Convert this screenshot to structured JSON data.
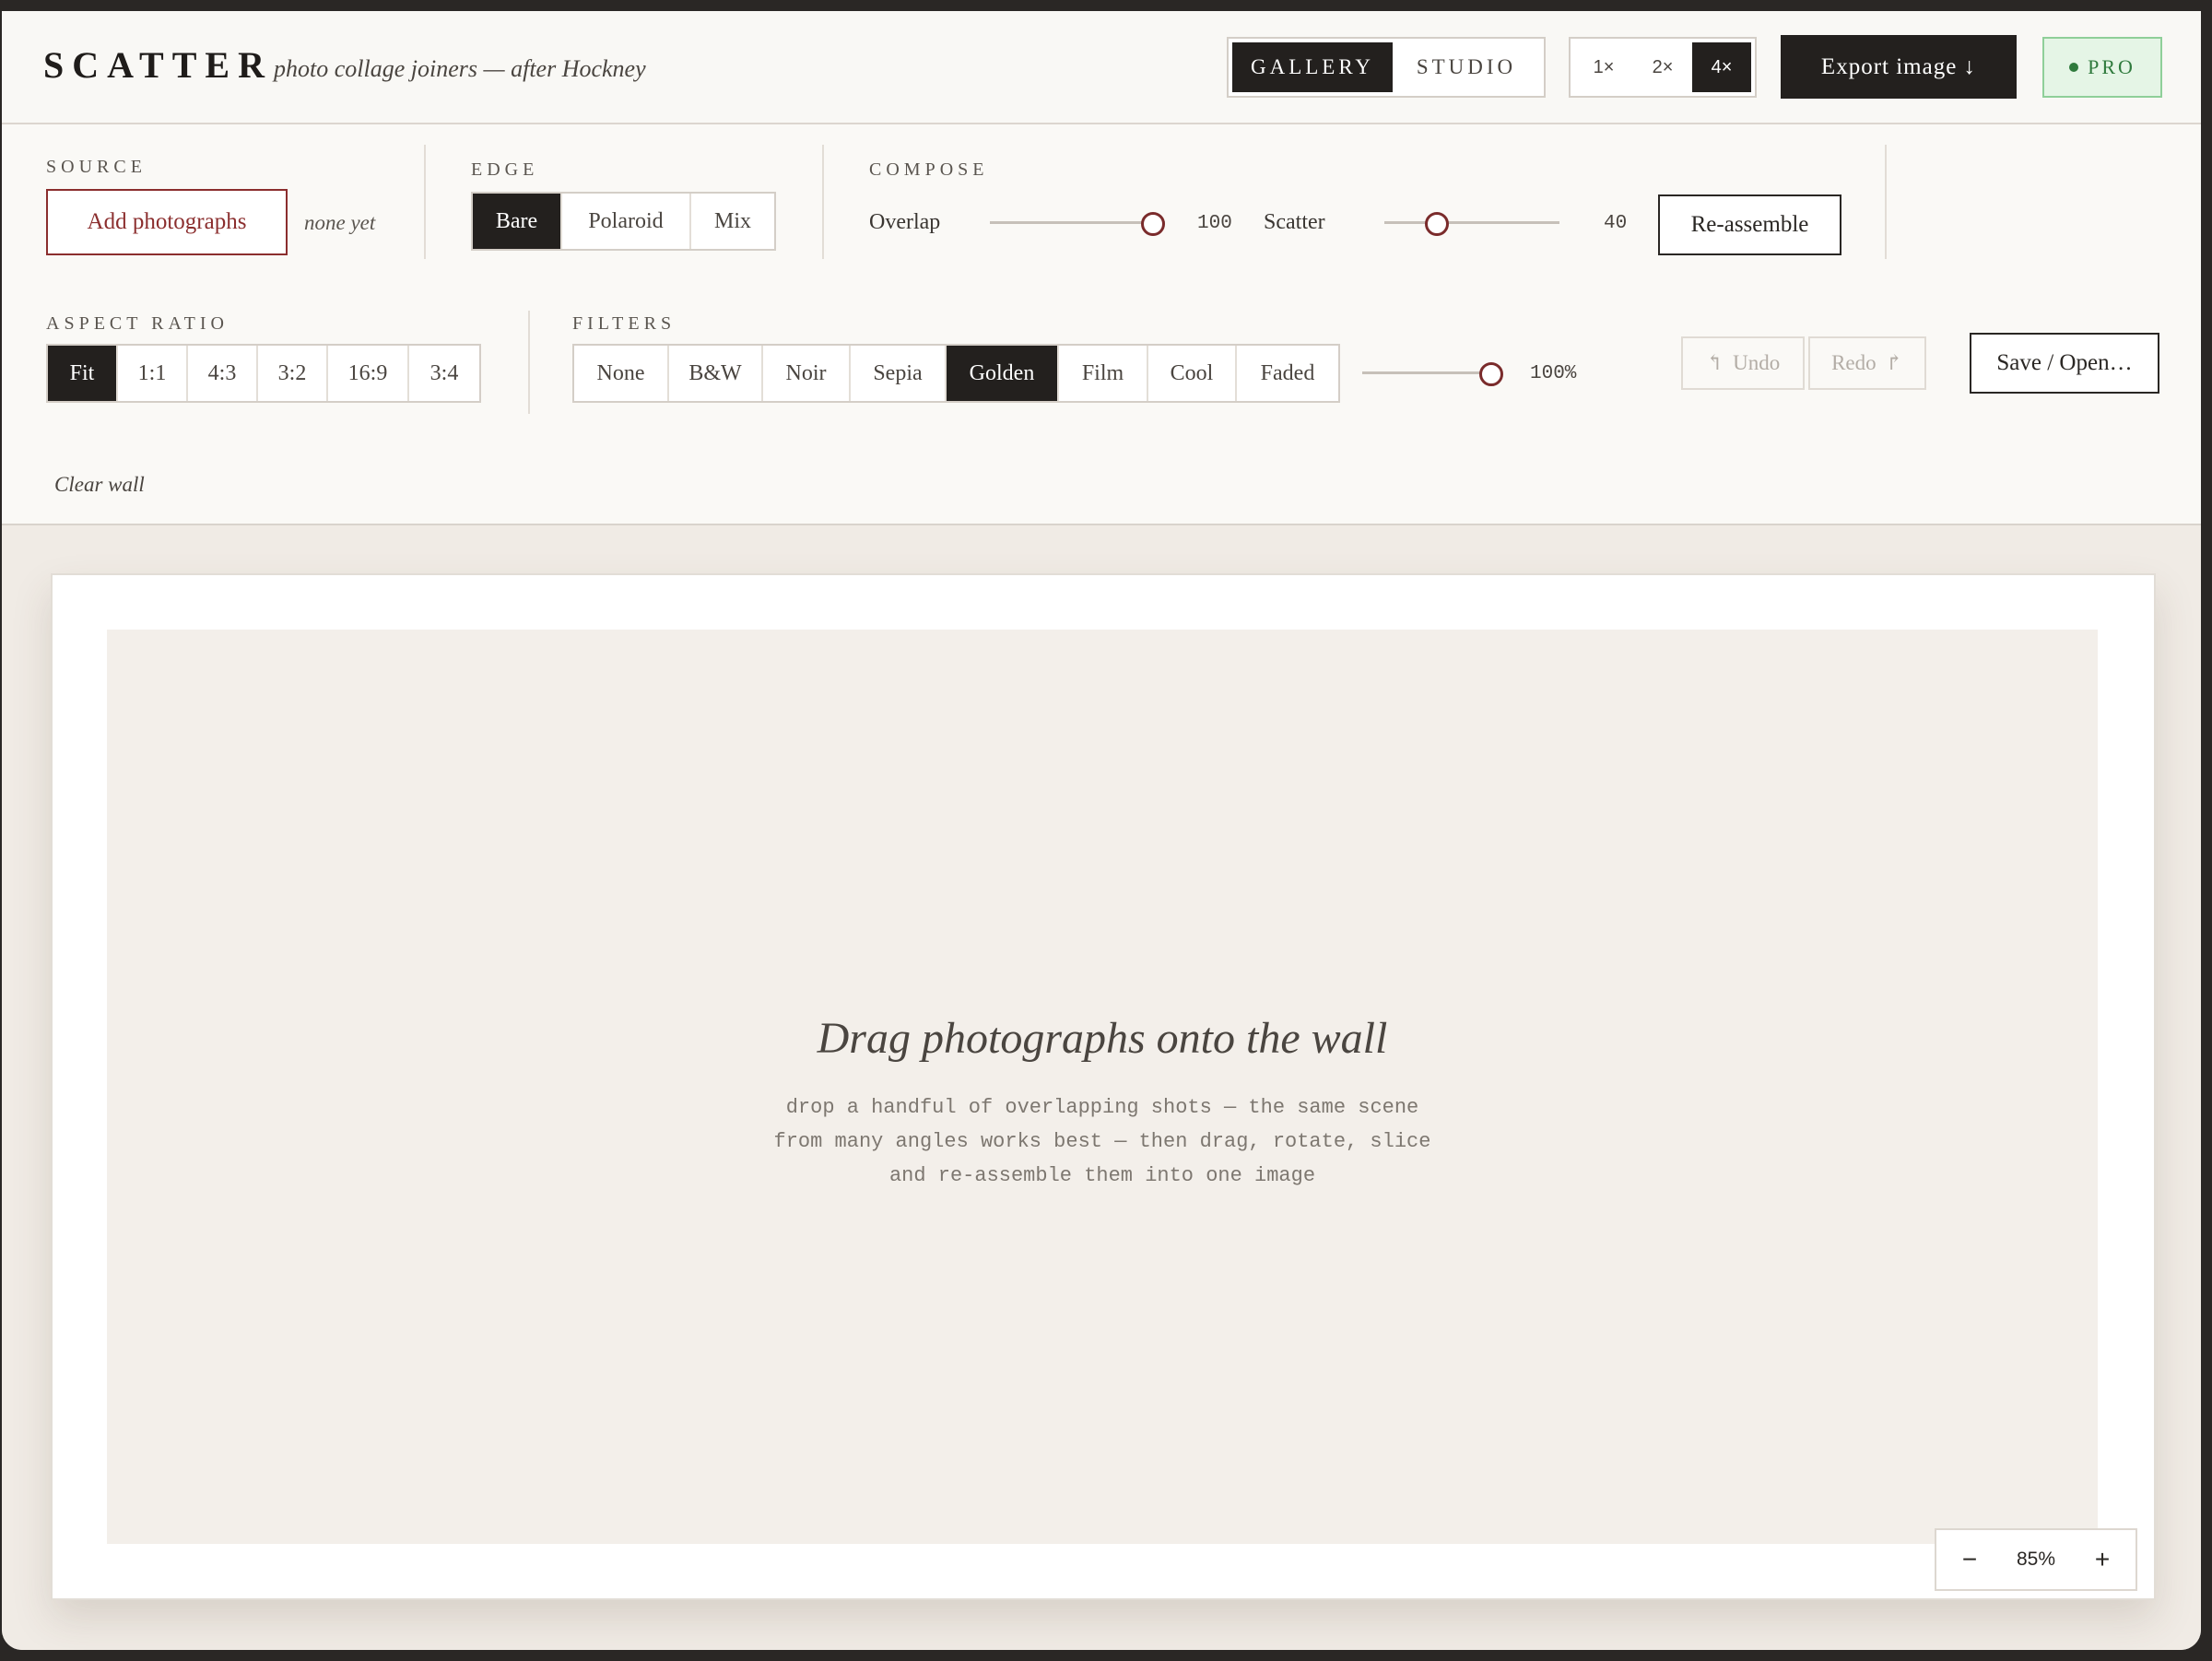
{
  "header": {
    "brand": "SCATTER",
    "tagline": "photo collage joiners — after Hockney",
    "modes": [
      {
        "label": "GALLERY",
        "active": true
      },
      {
        "label": "STUDIO",
        "active": false
      }
    ],
    "scales": [
      {
        "label": "1×",
        "active": false
      },
      {
        "label": "2×",
        "active": false
      },
      {
        "label": "4×",
        "active": true
      }
    ],
    "export_label": "Export image ↓",
    "pro_label": "PRO"
  },
  "toolbar": {
    "source": {
      "label": "SOURCE",
      "add_label": "Add photographs",
      "status": "none yet"
    },
    "edge": {
      "label": "EDGE",
      "options": [
        {
          "label": "Bare",
          "active": true
        },
        {
          "label": "Polaroid",
          "active": false
        },
        {
          "label": "Mix",
          "active": false
        }
      ]
    },
    "compose": {
      "label": "COMPOSE",
      "overlap": {
        "label": "Overlap",
        "value": "100",
        "fraction": 0.93
      },
      "scatter": {
        "label": "Scatter",
        "value": "40",
        "fraction": 0.3
      },
      "reassemble_label": "Re-assemble"
    },
    "aspect": {
      "label": "ASPECT RATIO",
      "options": [
        {
          "label": "Fit",
          "active": true
        },
        {
          "label": "1:1",
          "active": false
        },
        {
          "label": "4:3",
          "active": false
        },
        {
          "label": "3:2",
          "active": false
        },
        {
          "label": "16:9",
          "active": false
        },
        {
          "label": "3:4",
          "active": false
        }
      ]
    },
    "filters": {
      "label": "FILTERS",
      "options": [
        {
          "label": "None",
          "active": false
        },
        {
          "label": "B&W",
          "active": false
        },
        {
          "label": "Noir",
          "active": false
        },
        {
          "label": "Sepia",
          "active": false
        },
        {
          "label": "Golden",
          "active": true
        },
        {
          "label": "Film",
          "active": false
        },
        {
          "label": "Cool",
          "active": false
        },
        {
          "label": "Faded",
          "active": false
        }
      ],
      "intensity": {
        "value": "100%",
        "fraction": 1.0
      }
    },
    "undo_label": "Undo",
    "redo_label": "Redo",
    "save_label": "Save / Open…",
    "clear_label": "Clear wall"
  },
  "canvas": {
    "title": "Drag photographs onto the wall",
    "body": "drop a handful of overlapping shots — the same scene from many angles works best — then drag, rotate, slice and re-assemble them into one image",
    "zoom": {
      "minus": "−",
      "value": "85%",
      "plus": "+"
    }
  },
  "colors": {
    "ink": "#23201e",
    "accent": "#8b2e2e",
    "pro_green": "#2f7a3d"
  }
}
